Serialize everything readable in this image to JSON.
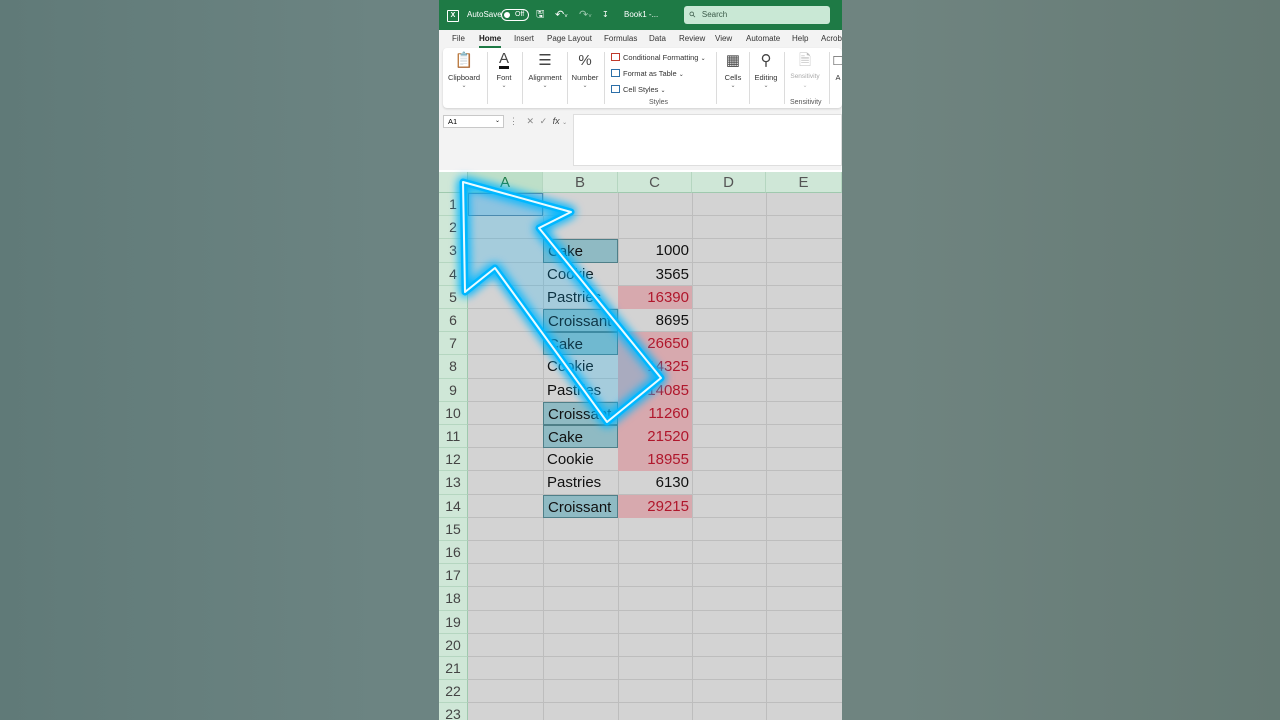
{
  "titlebar": {
    "autosave_label": "AutoSave",
    "autosave_state": "Off",
    "book_title": "Book1 -...",
    "search_placeholder": "Search"
  },
  "tabs": [
    "File",
    "Home",
    "Insert",
    "Page Layout",
    "Formulas",
    "Data",
    "Review",
    "View",
    "Automate",
    "Help",
    "Acrob"
  ],
  "active_tab": "Home",
  "ribbon": {
    "clipboard": "Clipboard",
    "font": "Font",
    "alignment": "Alignment",
    "number": "Number",
    "conditional_formatting": "Conditional Formatting",
    "format_as_table": "Format as Table",
    "cell_styles": "Cell Styles",
    "styles_group": "Styles",
    "cells": "Cells",
    "editing": "Editing",
    "sensitivity": "Sensitivity",
    "sensitivity_group": "Sensitivity",
    "truncated": "A"
  },
  "formula_bar": {
    "name_box": "A1",
    "fx": "fx",
    "content": ""
  },
  "columns": [
    "A",
    "B",
    "C",
    "D",
    "E"
  ],
  "rows": [
    "1",
    "2",
    "3",
    "4",
    "5",
    "6",
    "7",
    "8",
    "9",
    "10",
    "11",
    "12",
    "13",
    "14",
    "15",
    "16",
    "17",
    "18",
    "19",
    "20",
    "21",
    "22",
    "23"
  ],
  "cells": {
    "B": [
      "",
      "",
      "Cake",
      "Cookie",
      "Pastries",
      "Croissant",
      "Cake",
      "Cookie",
      "Pastries",
      "Croissant",
      "Cake",
      "Cookie",
      "Pastries",
      "Croissant"
    ],
    "C": [
      "",
      "",
      "1000",
      "3565",
      "16390",
      "8695",
      "26650",
      "14325",
      "14085",
      "11260",
      "21520",
      "18955",
      "6130",
      "29215"
    ]
  },
  "colors": {
    "excel_green": "#1e7a45",
    "dup_fill": "#8fbac3",
    "high_fill": "#d7a9ae",
    "high_text": "#b0172c",
    "arrow_glow": "#00b7ff"
  }
}
